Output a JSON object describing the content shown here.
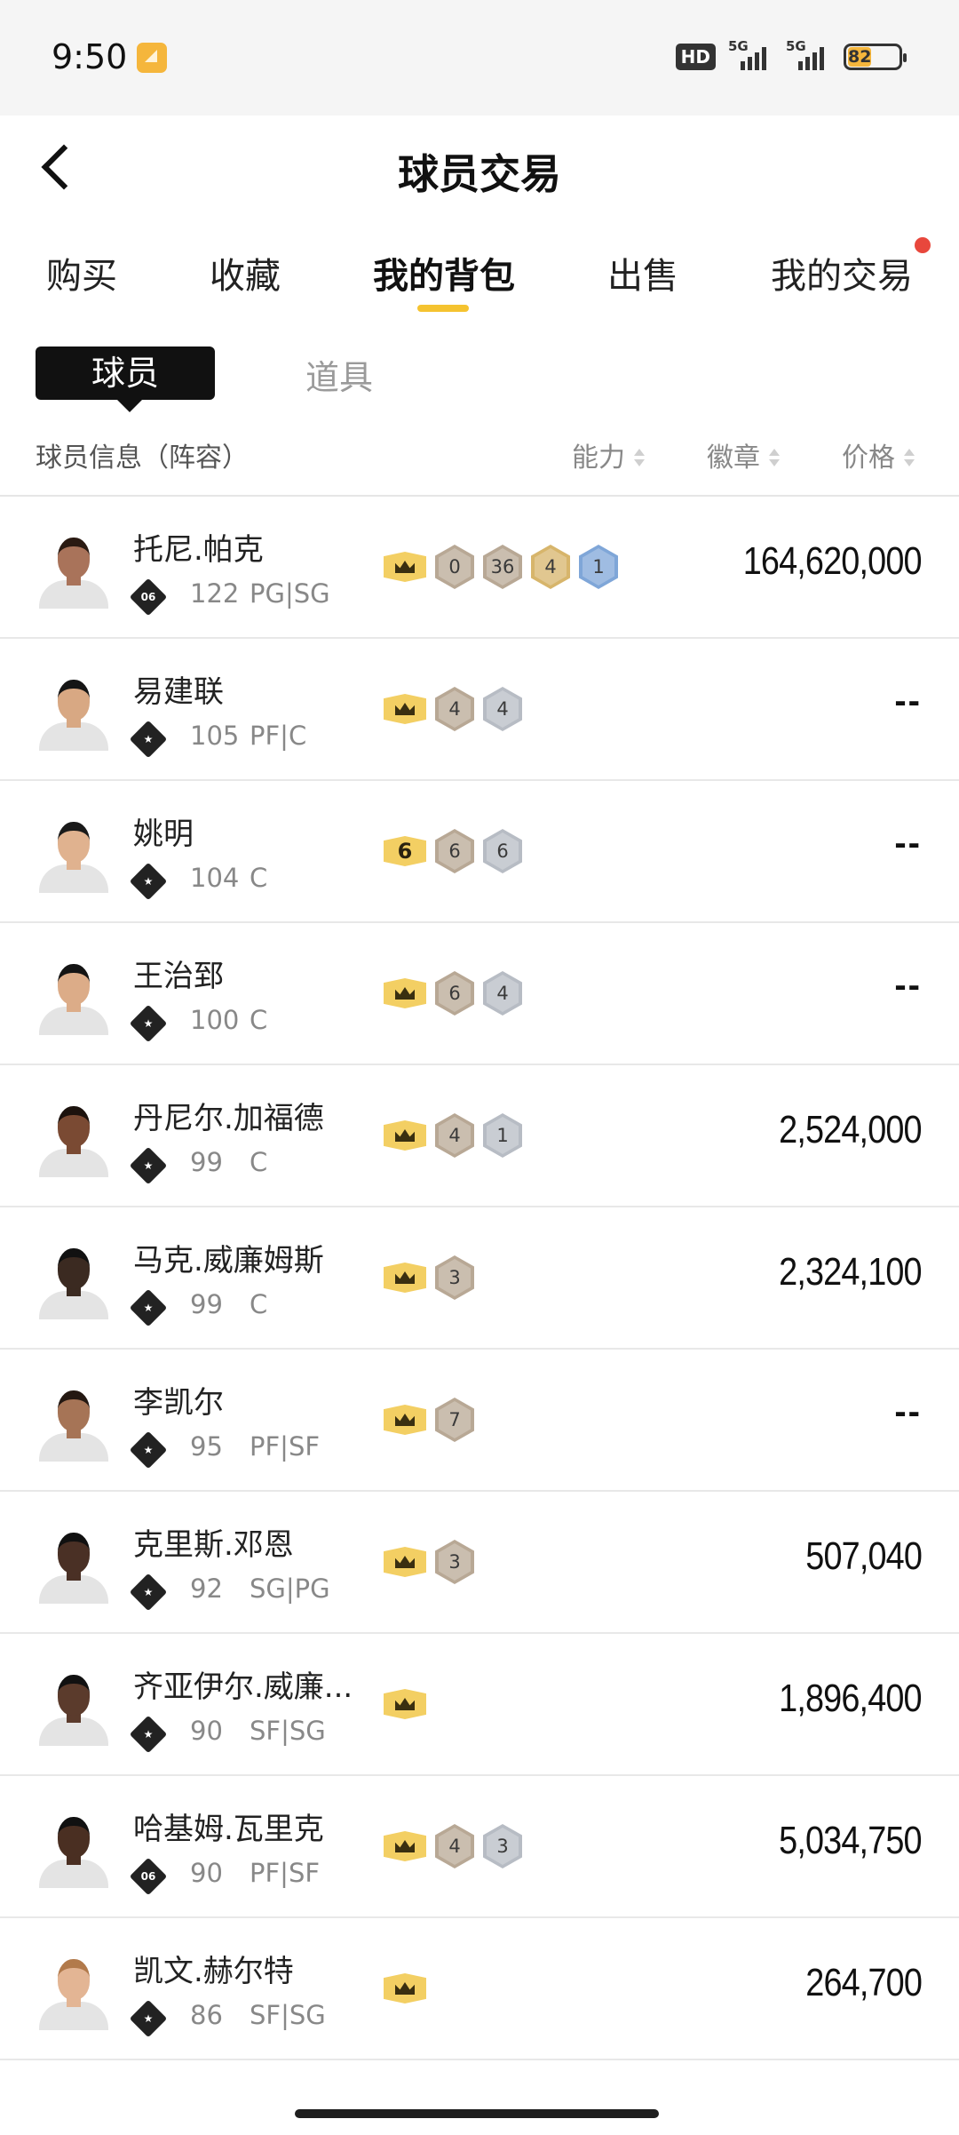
{
  "status_bar": {
    "time": "9:50",
    "hd_label": "HD",
    "signal1": "5G",
    "signal2": "5G",
    "battery": "82"
  },
  "header": {
    "title": "球员交易"
  },
  "tabs": [
    {
      "label": "购买"
    },
    {
      "label": "收藏"
    },
    {
      "label": "我的背包"
    },
    {
      "label": "出售"
    },
    {
      "label": "我的交易"
    }
  ],
  "subtabs": {
    "active": "球员",
    "other": "道具"
  },
  "columns": {
    "info": "球员信息（阵容）",
    "ability": "能力",
    "badge": "徽章",
    "price": "价格"
  },
  "players": [
    {
      "name": "托尼.帕克",
      "rank": "06",
      "rating": "122",
      "position": "PG|SG",
      "crown": "",
      "badges": [
        {
          "v": "0",
          "c": "bronze"
        },
        {
          "v": "36",
          "c": "bronze"
        },
        {
          "v": "4",
          "c": "gold"
        },
        {
          "v": "1",
          "c": "blue"
        }
      ],
      "price": "164,620,000",
      "skin": "#a9735a",
      "hair": "#2a1a12"
    },
    {
      "name": "易建联",
      "rank": "",
      "rating": "105",
      "position": "PF|C",
      "crown": "",
      "badges": [
        {
          "v": "4",
          "c": "bronze"
        },
        {
          "v": "4",
          "c": "silver"
        }
      ],
      "price": "--",
      "skin": "#d8a883",
      "hair": "#151515"
    },
    {
      "name": "姚明",
      "rank": "",
      "rating": "104",
      "position": "C",
      "crown": "6",
      "badges": [
        {
          "v": "6",
          "c": "bronze"
        },
        {
          "v": "6",
          "c": "silver"
        }
      ],
      "price": "--",
      "skin": "#e0b28f",
      "hair": "#1a1a1a"
    },
    {
      "name": "王治郅",
      "rank": "",
      "rating": "100",
      "position": "C",
      "crown": "",
      "badges": [
        {
          "v": "6",
          "c": "bronze"
        },
        {
          "v": "4",
          "c": "silver"
        }
      ],
      "price": "--",
      "skin": "#dcac88",
      "hair": "#141414"
    },
    {
      "name": "丹尼尔.加福德",
      "rank": "",
      "rating": "99",
      "position": "C",
      "crown": "",
      "badges": [
        {
          "v": "4",
          "c": "bronze"
        },
        {
          "v": "1",
          "c": "silver"
        }
      ],
      "price": "2,524,000",
      "skin": "#7a4a33",
      "hair": "#1c120d"
    },
    {
      "name": "马克.威廉姆斯",
      "rank": "",
      "rating": "99",
      "position": "C",
      "crown": "",
      "badges": [
        {
          "v": "3",
          "c": "bronze"
        }
      ],
      "price": "2,324,100",
      "skin": "#3b2a21",
      "hair": "#111"
    },
    {
      "name": "李凯尔",
      "rank": "",
      "rating": "95",
      "position": "PF|SF",
      "crown": "",
      "badges": [
        {
          "v": "7",
          "c": "bronze"
        }
      ],
      "price": "--",
      "skin": "#a67456",
      "hair": "#241812"
    },
    {
      "name": "克里斯.邓恩",
      "rank": "",
      "rating": "92",
      "position": "SG|PG",
      "crown": "",
      "badges": [
        {
          "v": "3",
          "c": "bronze"
        }
      ],
      "price": "507,040",
      "skin": "#4a3025",
      "hair": "#111"
    },
    {
      "name": "齐亚伊尔.威廉...",
      "rank": "",
      "rating": "90",
      "position": "SF|SG",
      "crown": "",
      "badges": [],
      "price": "1,896,400",
      "skin": "#5b3b2c",
      "hair": "#111"
    },
    {
      "name": "哈基姆.瓦里克",
      "rank": "06",
      "rating": "90",
      "position": "PF|SF",
      "crown": "",
      "badges": [
        {
          "v": "4",
          "c": "bronze"
        },
        {
          "v": "3",
          "c": "silver"
        }
      ],
      "price": "5,034,750",
      "skin": "#4a2f22",
      "hair": "#111"
    },
    {
      "name": "凯文.赫尔特",
      "rank": "",
      "rating": "86",
      "position": "SF|SG",
      "crown": "",
      "badges": [],
      "price": "264,700",
      "skin": "#e3b594",
      "hair": "#b27a4b"
    }
  ],
  "partial_row_name": "··· ·······"
}
